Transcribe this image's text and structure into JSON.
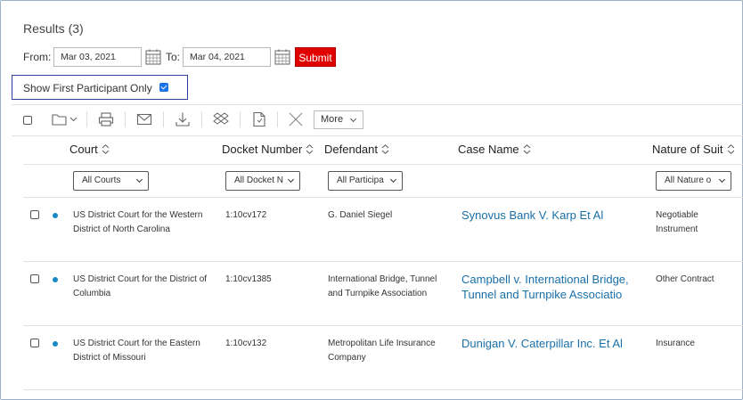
{
  "results_title": "Results (3)",
  "date_filter": {
    "from_label": "From:",
    "from_value": "Mar 03, 2021",
    "to_label": "To:",
    "to_value": "Mar 04, 2021",
    "submit_label": "Submit"
  },
  "show_first": {
    "label": "Show First Participant Only",
    "checked": true
  },
  "toolbar": {
    "icons": [
      "select-all-checkbox",
      "folder-icon",
      "print-icon",
      "email-icon",
      "download-icon",
      "dropbox-icon",
      "document-icon",
      "close-icon"
    ],
    "more_label": "More"
  },
  "columns": {
    "court": "Court",
    "docket": "Docket Number",
    "defendant": "Defendant",
    "case_name": "Case Name",
    "nature": "Nature of Suit"
  },
  "filters": {
    "court": "All Courts",
    "docket": "All Docket N",
    "defendant": "All Participa",
    "nature": "All Nature o"
  },
  "rows": [
    {
      "court_line1": "US District Court for the Western",
      "court_line2": "District of North Carolina",
      "docket": "1:10cv172",
      "defendant_line1": "G. Daniel Siegel",
      "defendant_line2": "",
      "case_line1": "Synovus Bank V. Karp Et Al",
      "case_line2": "",
      "nature_line1": "Negotiable",
      "nature_line2": "Instrument"
    },
    {
      "court_line1": "US District Court for the District of",
      "court_line2": "Columbia",
      "docket": "1:10cv1385",
      "defendant_line1": "International Bridge, Tunnel",
      "defendant_line2": "and Turnpike Association",
      "case_line1": "Campbell v. International Bridge,",
      "case_line2": "Tunnel and Turnpike Associatio",
      "nature_line1": "Other Contract",
      "nature_line2": ""
    },
    {
      "court_line1": "US District Court for the Eastern",
      "court_line2": "District of Missouri",
      "docket": "1:10cv132",
      "defendant_line1": "Metropolitan Life Insurance",
      "defendant_line2": "Company",
      "case_line1": "Dunigan V. Caterpillar Inc. Et Al",
      "case_line2": "",
      "nature_line1": "Insurance",
      "nature_line2": ""
    }
  ],
  "colors": {
    "link": "#1a6fa8",
    "submit": "#e00000",
    "dot": "#1a89c8"
  }
}
